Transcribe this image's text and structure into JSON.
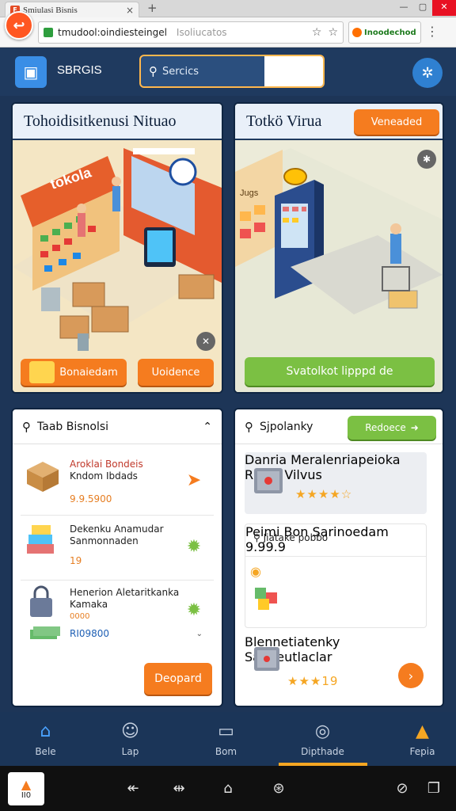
{
  "browser": {
    "tab_title": "Smiulasi Bisnis",
    "url": "tmudool:oindiesteingel",
    "url_hint": "Isoliucatos",
    "extension_label": "Inoodechod"
  },
  "app": {
    "brand": "SBRGIS",
    "search_placeholder": "Sercics"
  },
  "panels": {
    "left": {
      "title": "Tohoidisitkenusi Nituao",
      "store_sign": "tokola",
      "btn_left": "Bonaiedam",
      "btn_right": "Uoidence"
    },
    "right": {
      "title": "Totkö Virua",
      "header_btn": "Veneaded",
      "machine_sign": "Jugs",
      "btn_bottom": "Svatolkot lipppd de"
    }
  },
  "cards": {
    "left": {
      "title": "Taab Bisnolsi",
      "items": [
        {
          "name_hl": "Aroklai Bondeis",
          "name": "Kndom Ibdads",
          "price": "9.9.5900"
        },
        {
          "name": "Dekenku Anamudar",
          "name2": "Sanmonnaden",
          "price": "19"
        },
        {
          "name": "Henerion Aletaritkanka",
          "name2": "Kamaka",
          "price": "RI09800",
          "tag": "0000"
        }
      ],
      "button": "Deopard"
    },
    "right": {
      "title": "Sjpolanky",
      "header_btn": "Redoece",
      "items": [
        {
          "name": "Danria Meralenriapeioka",
          "name2": "Rdooj Vilvus",
          "rating": "★★★★☆"
        },
        {
          "header": "Jiatake pobbo",
          "name": "Peimi Bon Sarinoedam",
          "price": "9.99.9"
        },
        {
          "name": "Blennetiatenky Sanpeutlaclar",
          "rating_text": "★★★19"
        }
      ]
    }
  },
  "bottom_nav": [
    {
      "label": "Bele",
      "icon": "home-icon"
    },
    {
      "label": "Lap",
      "icon": "user-icon"
    },
    {
      "label": "Bom",
      "icon": "tv-icon"
    },
    {
      "label": "Dipthade",
      "icon": "globe-icon"
    },
    {
      "label": "Fepia",
      "icon": "shop-icon"
    }
  ],
  "os": {
    "home_label": "II0"
  },
  "colors": {
    "header_bg": "#1f3a5f",
    "accent_orange": "#f57c1f",
    "accent_green": "#7bc043",
    "search_border": "#ffb74d"
  }
}
